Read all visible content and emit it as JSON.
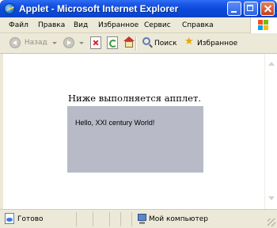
{
  "window": {
    "title": "Applet - Microsoft Internet Explorer",
    "icon": "ie-icon",
    "controls": [
      "minimize-icon",
      "maximize-icon",
      "close-icon"
    ]
  },
  "menu": {
    "items": [
      "Файл",
      "Правка",
      "Вид",
      "Избранное",
      "Сервис",
      "Справка"
    ]
  },
  "toolbar": {
    "back_label": "Назад",
    "search_label": "Поиск",
    "favorites_label": "Избранное"
  },
  "page": {
    "caption": "Ниже выполняется апплет.",
    "applet_text": "Hello, XXI century World!",
    "applet_background": "#b8bbc7"
  },
  "status": {
    "text": "Готово",
    "zone": "Мой компьютер"
  },
  "colors": {
    "titlebar": "#0a47d3",
    "chrome": "#ece9d8"
  }
}
